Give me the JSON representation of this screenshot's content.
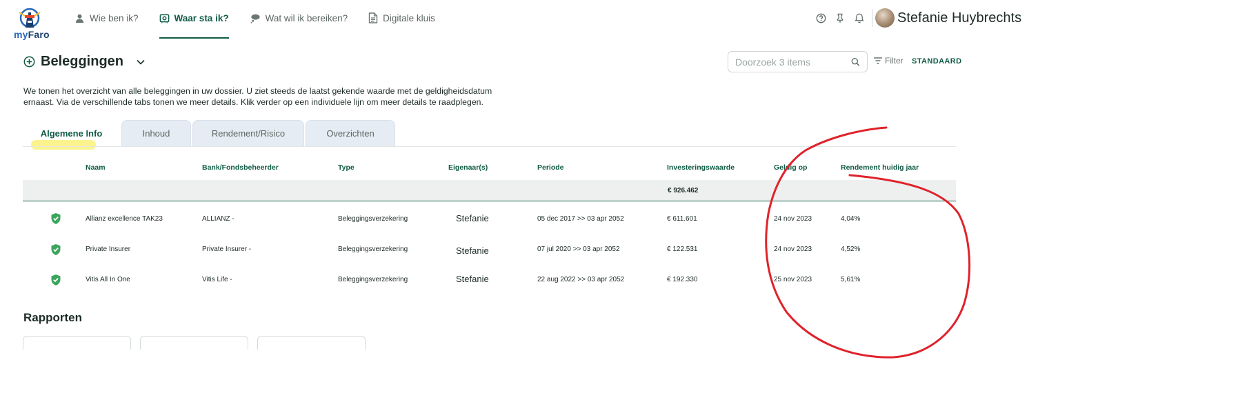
{
  "app": {
    "logo_text_a": "my",
    "logo_text_b": "Faro",
    "user_name": "Stefanie Huybrechts",
    "accent_color": "#0f5b45"
  },
  "nav": [
    {
      "label": "Wie ben ik?",
      "icon": "person-icon",
      "active": false
    },
    {
      "label": "Waar sta ik?",
      "icon": "safe-icon",
      "active": true
    },
    {
      "label": "Wat wil ik bereiken?",
      "icon": "thought-bubble-icon",
      "active": false
    },
    {
      "label": "Digitale kluis",
      "icon": "document-icon",
      "active": false
    }
  ],
  "top_icons": [
    "help-icon",
    "pin-icon",
    "bell-icon"
  ],
  "section": {
    "title": "Beleggingen",
    "search_placeholder": "Doorzoek 3 items",
    "filter_label": "Filter",
    "standaard_label": "STANDAARD",
    "description": "We tonen het overzicht van alle beleggingen in uw dossier. U ziet steeds de laatst gekende waarde met de geldigheidsdatum ernaast. Via de verschillende tabs tonen we meer details. Klik verder op een individuele lijn om meer details te raadplegen."
  },
  "tabs": [
    {
      "label": "Algemene Info",
      "active": true
    },
    {
      "label": "Inhoud",
      "active": false
    },
    {
      "label": "Rendement/Risico",
      "active": false
    },
    {
      "label": "Overzichten",
      "active": false
    }
  ],
  "table": {
    "headers": {
      "naam": "Naam",
      "bank": "Bank/Fondsbeheerder",
      "type": "Type",
      "eigenaar": "Eigenaar(s)",
      "periode": "Periode",
      "investeringswaarde": "Investeringswaarde",
      "geldig_op": "Geldig op",
      "rendement": "Rendement huidig jaar"
    },
    "total_investeringswaarde": "€ 926.462",
    "rows": [
      {
        "naam": "Allianz excellence TAK23",
        "bank": "ALLIANZ -",
        "type": "Beleggingsverzekering",
        "eigenaar": "Stefanie",
        "periode": "05 dec 2017 >> 03 apr 2052",
        "investeringswaarde": "€ 611.601",
        "geldig_op": "24 nov 2023",
        "rendement": "4,04%"
      },
      {
        "naam": "Private Insurer",
        "bank": "Private Insurer -",
        "type": "Beleggingsverzekering",
        "eigenaar": "Stefanie",
        "periode": "07 jul 2020 >> 03 apr 2052",
        "investeringswaarde": "€ 122.531",
        "geldig_op": "24 nov 2023",
        "rendement": "4,52%"
      },
      {
        "naam": "Vitis All In One",
        "bank": "Vitis Life -",
        "type": "Beleggingsverzekering",
        "eigenaar": "Stefanie",
        "periode": "22 aug 2022 >> 03 apr 2052",
        "investeringswaarde": "€ 192.330",
        "geldig_op": "25 nov 2023",
        "rendement": "5,61%"
      }
    ]
  },
  "reports": {
    "title": "Rapporten"
  }
}
